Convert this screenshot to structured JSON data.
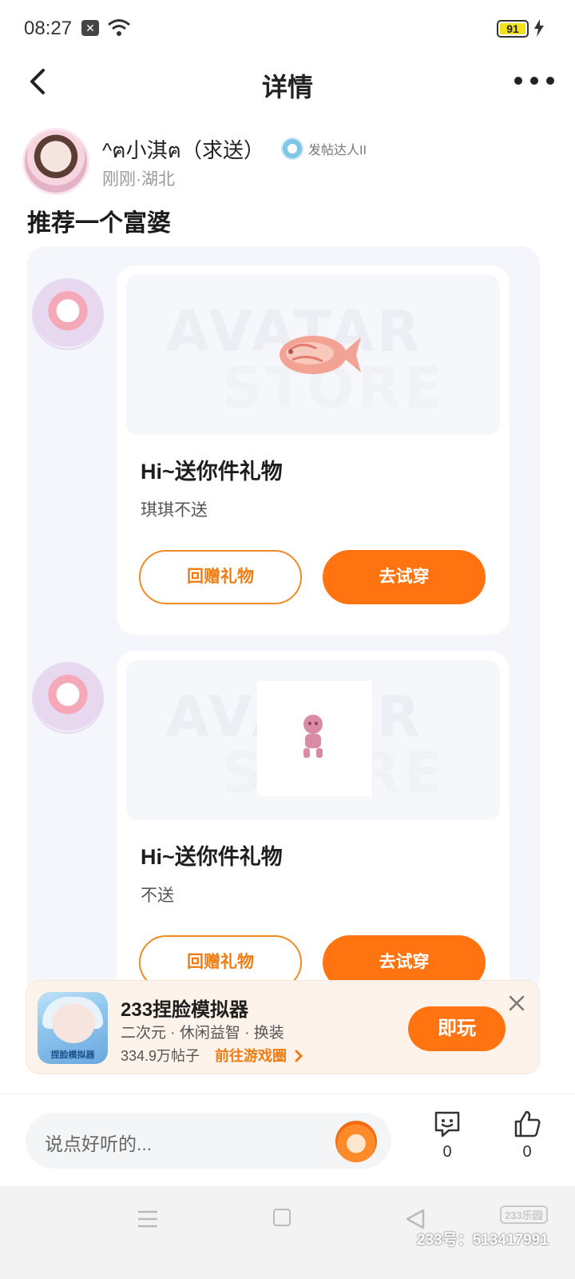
{
  "status_bar": {
    "time": "08:27",
    "battery": "91"
  },
  "header": {
    "title": "详情"
  },
  "author": {
    "name": "^ฅ小淇ฅ（求送）",
    "badge": "发帖达人II",
    "meta": "刚刚·湖北"
  },
  "post": {
    "text": "推荐一个富婆"
  },
  "cards": [
    {
      "title": "Hi~送你件礼物",
      "subtitle": "琪琪不送",
      "btn_return": "回赠礼物",
      "btn_try": "去试穿",
      "watermark_top": "AVATAR",
      "watermark_bottom": "STORE"
    },
    {
      "title": "Hi~送你件礼物",
      "subtitle": "不送",
      "btn_return": "回赠礼物",
      "btn_try": "去试穿",
      "watermark_top": "AVATAR",
      "watermark_bottom": "STORE"
    }
  ],
  "game": {
    "title": "233捏脸模拟器",
    "tags": "二次元 · 休闲益智 · 换装",
    "posts": "334.9万帖子",
    "link": "前往游戏圈",
    "play": "即玩",
    "icon_label": "捏脸模拟器"
  },
  "comment_bar": {
    "placeholder": "说点好听的...",
    "comments": "0",
    "likes": "0"
  },
  "watermark": {
    "logo": "233乐园",
    "id": "233号：513417991"
  },
  "colors": {
    "accent": "#ff7410",
    "accent_outline": "#f28a22"
  }
}
